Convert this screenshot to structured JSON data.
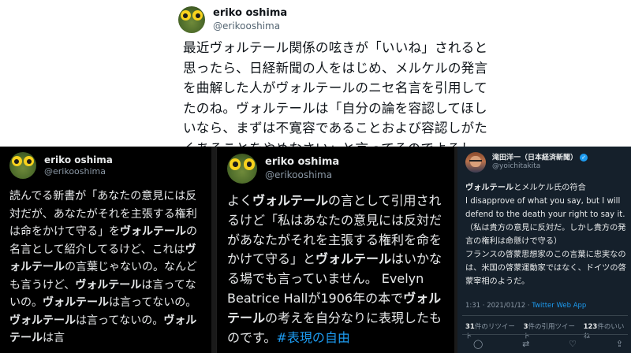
{
  "top_tweet": {
    "name": "eriko oshima",
    "handle": "@erikooshima",
    "body": "最近ヴォルテール関係の呟きが「いいね」されると思ったら、日経新聞の人をはじめ、メルケルの発言を曲解した人がヴォルテールのニセ名言を引用してたのね。ヴォルテールは「自分の論を容認してほしいなら、まずは不寛容であることおよび容認しがたくあることをやめなさい」と言ってるのでよろしく。"
  },
  "tweet_b1": {
    "name": "eriko oshima",
    "handle": "@erikooshima",
    "segments": [
      {
        "t": "読んでる新書が「あなたの意見には反対だが、あなたがそれを主張する権利は命をかけて守る」を",
        "b": false
      },
      {
        "t": "ヴォルテール",
        "b": true
      },
      {
        "t": "の名言として紹介してるけど、これは",
        "b": false
      },
      {
        "t": "ヴォルテール",
        "b": true
      },
      {
        "t": "の言葉じゃないの。なんども言うけど、",
        "b": false
      },
      {
        "t": "ヴォルテール",
        "b": true
      },
      {
        "t": "は言ってないの。",
        "b": false
      },
      {
        "t": "ヴォルテール",
        "b": true
      },
      {
        "t": "は言ってないの。",
        "b": false
      },
      {
        "t": "ヴォルテール",
        "b": true
      },
      {
        "t": "は言ってないの。",
        "b": false
      },
      {
        "t": "ヴォルテール",
        "b": true
      },
      {
        "t": "は言",
        "b": false
      }
    ]
  },
  "tweet_b2": {
    "name": "eriko oshima",
    "handle": "@erikooshima",
    "segments": [
      {
        "t": "よく",
        "b": false
      },
      {
        "t": "ヴォルテール",
        "b": true
      },
      {
        "t": "の言として引用されるけど「私はあなたの意見には反対だがあなたがそれを主張する権利を命をかけて守る」と",
        "b": false
      },
      {
        "t": "ヴォルテール",
        "b": true
      },
      {
        "t": "はいかなる場でも言っていません。 Evelyn Beatrice Hallが1906年の本で",
        "b": false
      },
      {
        "t": "ヴォルテール",
        "b": true
      },
      {
        "t": "の考えを自分なりに表現したものです。",
        "b": false
      },
      {
        "t": "#表現の自由",
        "b": false,
        "tag": true
      }
    ]
  },
  "tweet_b3": {
    "name": "滝田洋一（日本経済新聞）",
    "handle": "@yoichitakita",
    "verified_icon": "verified-badge-icon",
    "segments": [
      {
        "t": "ヴォルテール",
        "b": true
      },
      {
        "t": "とメルケル氏の符合\nI disapprove of what you say, but I will defend to the death your right to say it.（私は貴方の意見に反対だ。しかし貴方の発言の権利は命懸けで守る）\nフランスの啓蒙思想家のこの言葉に忠実なのは、米国の啓蒙運動家ではなく、ドイツの啓蒙宰相のようだ。",
        "b": false
      }
    ],
    "meta_time": "1:31 · 2021/01/12 · ",
    "meta_source": "Twitter Web App",
    "stats": [
      {
        "num": "31",
        "label": "件のリツイート"
      },
      {
        "num": "3",
        "label": "件の引用ツイート"
      },
      {
        "num": "123",
        "label": "件のいいね"
      }
    ],
    "actions": [
      {
        "name": "reply-icon",
        "glyph": "◯"
      },
      {
        "name": "retweet-icon",
        "glyph": "⇄"
      },
      {
        "name": "like-icon",
        "glyph": "♡"
      },
      {
        "name": "share-icon",
        "glyph": "⇪"
      }
    ]
  },
  "colors": {
    "accent": "#1d9bf0",
    "dark_bg": "#000000",
    "dim_bg": "#15202b"
  }
}
